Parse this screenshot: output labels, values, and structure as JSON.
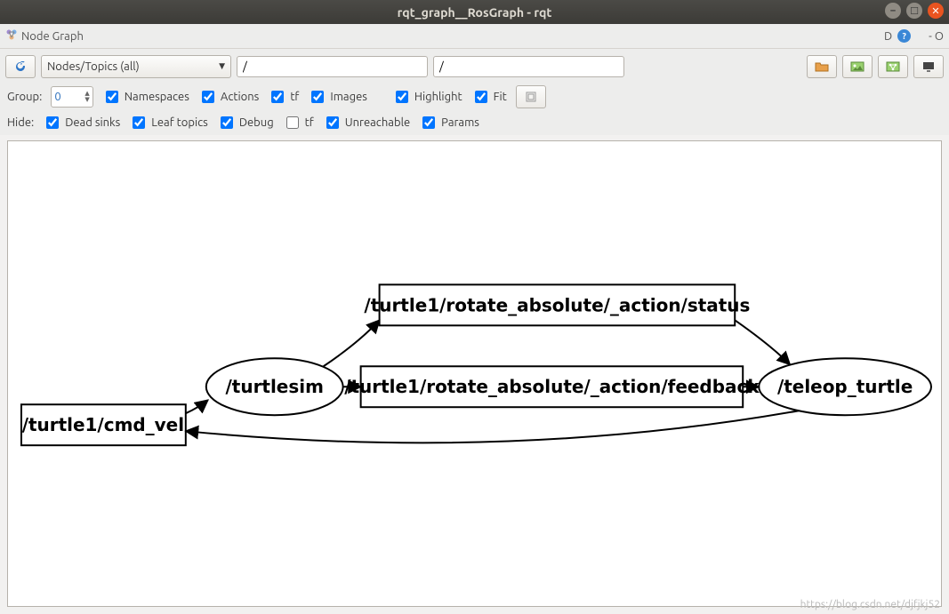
{
  "window": {
    "title": "rqt_graph__RosGraph - rqt"
  },
  "menubar": {
    "plugin_title": "Node Graph",
    "dock_hint": "D",
    "menu_hint": "- O"
  },
  "toolbar": {
    "filter_mode": "Nodes/Topics (all)",
    "filter_node": "/",
    "filter_topic": "/"
  },
  "group_row": {
    "label": "Group:",
    "depth": "0",
    "namespaces": {
      "label": "Namespaces",
      "checked": true
    },
    "actions": {
      "label": "Actions",
      "checked": true
    },
    "tf": {
      "label": "tf",
      "checked": true
    },
    "images": {
      "label": "Images",
      "checked": true
    },
    "highlight": {
      "label": "Highlight",
      "checked": true
    },
    "fit": {
      "label": "Fit",
      "checked": true
    }
  },
  "hide_row": {
    "label": "Hide:",
    "dead_sinks": {
      "label": "Dead sinks",
      "checked": true
    },
    "leaf_topics": {
      "label": "Leaf topics",
      "checked": true
    },
    "debug": {
      "label": "Debug",
      "checked": true
    },
    "tf": {
      "label": "tf",
      "checked": false
    },
    "unreachable": {
      "label": "Unreachable",
      "checked": true
    },
    "params": {
      "label": "Params",
      "checked": true
    }
  },
  "graph": {
    "nodes": {
      "cmd_vel": "/turtle1/cmd_vel",
      "turtlesim": "/turtlesim",
      "action_status": "/turtle1/rotate_absolute/_action/status",
      "action_feedback": "/turtle1/rotate_absolute/_action/feedback",
      "teleop": "/teleop_turtle"
    }
  },
  "watermark": "https://blog.csdn.net/djfjkj52"
}
